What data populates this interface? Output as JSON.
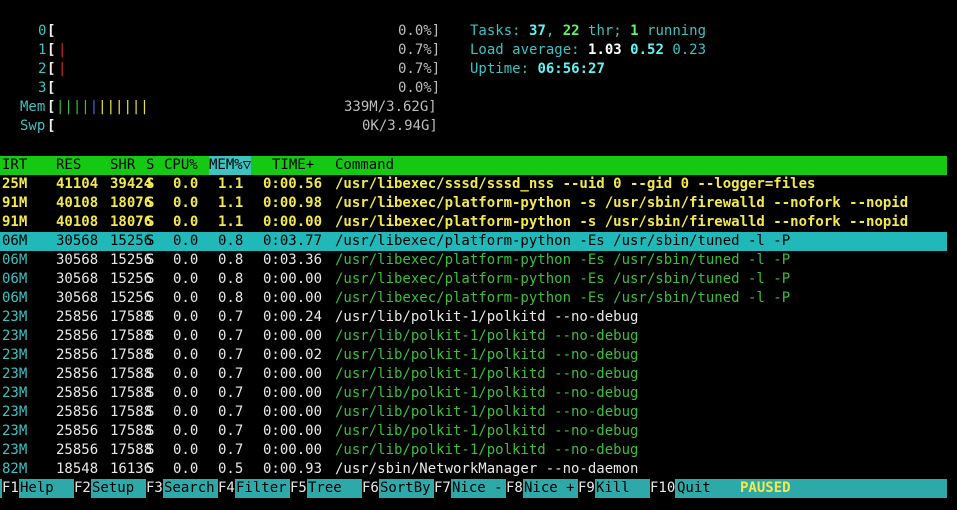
{
  "meters": {
    "cpus": [
      {
        "label": "0",
        "value": "0.0%]"
      },
      {
        "label": "1",
        "value": "0.7%]"
      },
      {
        "label": "2",
        "value": "0.7%]"
      },
      {
        "label": "3",
        "value": "0.0%]"
      }
    ],
    "mem": {
      "label": "Mem",
      "value": "339M/3.62G]"
    },
    "swp": {
      "label": "Swp",
      "value": "0K/3.94G]"
    }
  },
  "summary": {
    "tasks_label": "Tasks: ",
    "tasks_count": "37",
    "threads": "22",
    "threads_label": " thr; ",
    "running": "1",
    "running_label": " running",
    "load_label": "Load average: ",
    "load1": "1.03",
    "load5": "0.52",
    "load15": "0.23",
    "uptime_label": "Uptime: ",
    "uptime": "06:56:27"
  },
  "header": {
    "virt": "IRT",
    "res": "RES",
    "shr": "SHR",
    "s": "S",
    "cpu": "CPU%",
    "mem": "MEM%▽",
    "time": "TIME+",
    "command": "Command"
  },
  "processes": [
    {
      "virt": "25M",
      "res": "41104",
      "shr": "39424",
      "s": "S",
      "cpu": "0.0",
      "mem": "1.1",
      "time": "0:00.56",
      "cmd": "/usr/libexec/sssd/sssd_nss --uid 0 --gid 0 --logger=files"
    },
    {
      "virt": "91M",
      "res": "40108",
      "shr": "18076",
      "s": "S",
      "cpu": "0.0",
      "mem": "1.1",
      "time": "0:00.98",
      "cmd": "/usr/libexec/platform-python -s /usr/sbin/firewalld --nofork --nopid"
    },
    {
      "virt": "91M",
      "res": "40108",
      "shr": "18076",
      "s": "S",
      "cpu": "0.0",
      "mem": "1.1",
      "time": "0:00.00",
      "cmd": "/usr/libexec/platform-python -s /usr/sbin/firewalld --nofork --nopid"
    },
    {
      "virt": "06M",
      "res": "30568",
      "shr": "15256",
      "s": "S",
      "cpu": "0.0",
      "mem": "0.8",
      "time": "0:03.77",
      "cmd": "/usr/libexec/platform-python -Es /usr/sbin/tuned -l -P"
    },
    {
      "virt": "06M",
      "res": "30568",
      "shr": "15256",
      "s": "S",
      "cpu": "0.0",
      "mem": "0.8",
      "time": "0:03.36",
      "cmd": "/usr/libexec/platform-python -Es /usr/sbin/tuned -l -P"
    },
    {
      "virt": "06M",
      "res": "30568",
      "shr": "15256",
      "s": "S",
      "cpu": "0.0",
      "mem": "0.8",
      "time": "0:00.00",
      "cmd": "/usr/libexec/platform-python -Es /usr/sbin/tuned -l -P"
    },
    {
      "virt": "06M",
      "res": "30568",
      "shr": "15256",
      "s": "S",
      "cpu": "0.0",
      "mem": "0.8",
      "time": "0:00.00",
      "cmd": "/usr/libexec/platform-python -Es /usr/sbin/tuned -l -P"
    },
    {
      "virt": "23M",
      "res": "25856",
      "shr": "17588",
      "s": "S",
      "cpu": "0.0",
      "mem": "0.7",
      "time": "0:00.24",
      "cmd": "/usr/lib/polkit-1/polkitd --no-debug"
    },
    {
      "virt": "23M",
      "res": "25856",
      "shr": "17588",
      "s": "S",
      "cpu": "0.0",
      "mem": "0.7",
      "time": "0:00.00",
      "cmd": "/usr/lib/polkit-1/polkitd --no-debug"
    },
    {
      "virt": "23M",
      "res": "25856",
      "shr": "17588",
      "s": "S",
      "cpu": "0.0",
      "mem": "0.7",
      "time": "0:00.02",
      "cmd": "/usr/lib/polkit-1/polkitd --no-debug"
    },
    {
      "virt": "23M",
      "res": "25856",
      "shr": "17588",
      "s": "S",
      "cpu": "0.0",
      "mem": "0.7",
      "time": "0:00.00",
      "cmd": "/usr/lib/polkit-1/polkitd --no-debug"
    },
    {
      "virt": "23M",
      "res": "25856",
      "shr": "17588",
      "s": "S",
      "cpu": "0.0",
      "mem": "0.7",
      "time": "0:00.00",
      "cmd": "/usr/lib/polkit-1/polkitd --no-debug"
    },
    {
      "virt": "23M",
      "res": "25856",
      "shr": "17588",
      "s": "S",
      "cpu": "0.0",
      "mem": "0.7",
      "time": "0:00.00",
      "cmd": "/usr/lib/polkit-1/polkitd --no-debug"
    },
    {
      "virt": "23M",
      "res": "25856",
      "shr": "17588",
      "s": "S",
      "cpu": "0.0",
      "mem": "0.7",
      "time": "0:00.00",
      "cmd": "/usr/lib/polkit-1/polkitd --no-debug"
    },
    {
      "virt": "23M",
      "res": "25856",
      "shr": "17588",
      "s": "S",
      "cpu": "0.0",
      "mem": "0.7",
      "time": "0:00.00",
      "cmd": "/usr/lib/polkit-1/polkitd --no-debug"
    },
    {
      "virt": "82M",
      "res": "18548",
      "shr": "16136",
      "s": "S",
      "cpu": "0.0",
      "mem": "0.5",
      "time": "0:00.93",
      "cmd": "/usr/sbin/NetworkManager --no-daemon"
    }
  ],
  "footer": {
    "keys": [
      {
        "key": "F1",
        "label": "Help"
      },
      {
        "key": "F2",
        "label": "Setup"
      },
      {
        "key": "F3",
        "label": "Search"
      },
      {
        "key": "F4",
        "label": "Filter"
      },
      {
        "key": "F5",
        "label": "Tree"
      },
      {
        "key": "F6",
        "label": "SortBy"
      },
      {
        "key": "F7",
        "label": "Nice -"
      },
      {
        "key": "F8",
        "label": "Nice +"
      },
      {
        "key": "F9",
        "label": "Kill"
      },
      {
        "key": "F10",
        "label": "Quit"
      }
    ],
    "status": "PAUSED"
  },
  "colors": {
    "header_bg": "#14c814",
    "selected_bg": "#20b8b8",
    "footer_bg": "#2ea9a9",
    "sorted_col_bg": "#3dc2c2"
  }
}
